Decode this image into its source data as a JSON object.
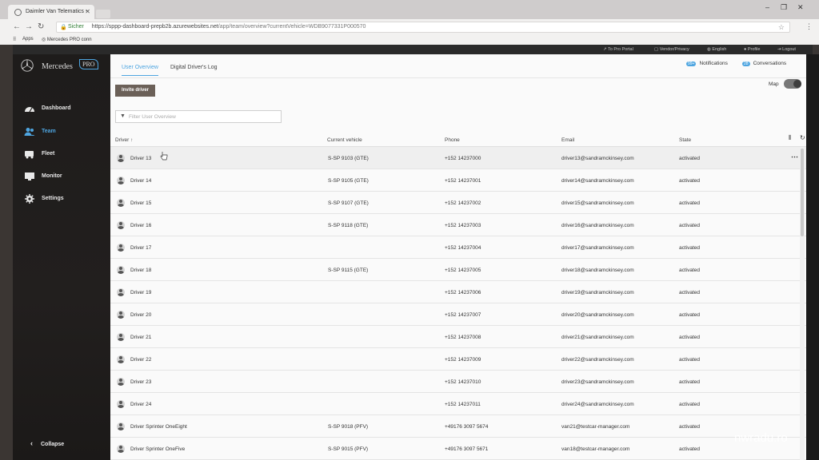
{
  "browser": {
    "tab_title": "Daimler Van Telematics -",
    "url_secure_label": "Sicher",
    "url_host": "https://sppp-dashboard-prepb2b.azurewebsites.net",
    "url_path": "/app/team/overview?currentVehicle=WDB9077331P000570",
    "bookmarks": [
      {
        "label": "Apps"
      },
      {
        "label": "Mercedes PRO conn"
      }
    ]
  },
  "topbar": {
    "items": [
      "To Pro Portal",
      "Vendor/Privacy",
      "English",
      "Profile",
      "Logout"
    ]
  },
  "sidebar": {
    "brand_text": "Mercedes",
    "brand_pro": "PRO",
    "items": [
      {
        "label": "Dashboard",
        "icon": "gauge-icon"
      },
      {
        "label": "Team",
        "icon": "team-icon",
        "active": true
      },
      {
        "label": "Fleet",
        "icon": "van-icon"
      },
      {
        "label": "Monitor",
        "icon": "monitor-icon"
      },
      {
        "label": "Settings",
        "icon": "gear-icon"
      }
    ],
    "collapse_label": "Collapse"
  },
  "main": {
    "tabs": [
      {
        "label": "User Overview",
        "active": true
      },
      {
        "label": "Digital Driver's Log"
      }
    ],
    "notifications": {
      "count": "99+",
      "label": "Notifications"
    },
    "conversations": {
      "count": "28",
      "label": "Conversations"
    },
    "invite_label": "Invite driver",
    "map_label": "Map",
    "filter_placeholder": "Filter User Overview"
  },
  "table": {
    "columns": [
      "Driver ↑",
      "Current vehicle",
      "Phone",
      "Email",
      "State"
    ],
    "rows": [
      {
        "driver": "Driver 13",
        "vehicle": "S-SP 9103 (GTE)",
        "phone": "+152 14237000",
        "email": "driver13@sandramckinsey.com",
        "state": "activated"
      },
      {
        "driver": "Driver 14",
        "vehicle": "S-SP 9105 (GTE)",
        "phone": "+152 14237001",
        "email": "driver14@sandramckinsey.com",
        "state": "activated"
      },
      {
        "driver": "Driver 15",
        "vehicle": "S-SP 9107 (GTE)",
        "phone": "+152 14237002",
        "email": "driver15@sandramckinsey.com",
        "state": "activated"
      },
      {
        "driver": "Driver 16",
        "vehicle": "S-SP 9118 (GTE)",
        "phone": "+152 14237003",
        "email": "driver16@sandramckinsey.com",
        "state": "activated"
      },
      {
        "driver": "Driver 17",
        "vehicle": "",
        "phone": "+152 14237004",
        "email": "driver17@sandramckinsey.com",
        "state": "activated"
      },
      {
        "driver": "Driver 18",
        "vehicle": "S-SP 9115 (GTE)",
        "phone": "+152 14237005",
        "email": "driver18@sandramckinsey.com",
        "state": "activated"
      },
      {
        "driver": "Driver 19",
        "vehicle": "",
        "phone": "+152 14237006",
        "email": "driver19@sandramckinsey.com",
        "state": "activated"
      },
      {
        "driver": "Driver 20",
        "vehicle": "",
        "phone": "+152 14237007",
        "email": "driver20@sandramckinsey.com",
        "state": "activated"
      },
      {
        "driver": "Driver 21",
        "vehicle": "",
        "phone": "+152 14237008",
        "email": "driver21@sandramckinsey.com",
        "state": "activated"
      },
      {
        "driver": "Driver 22",
        "vehicle": "",
        "phone": "+152 14237009",
        "email": "driver22@sandramckinsey.com",
        "state": "activated"
      },
      {
        "driver": "Driver 23",
        "vehicle": "",
        "phone": "+152 14237010",
        "email": "driver23@sandramckinsey.com",
        "state": "activated"
      },
      {
        "driver": "Driver 24",
        "vehicle": "",
        "phone": "+152 14237011",
        "email": "driver24@sandramckinsey.com",
        "state": "activated"
      },
      {
        "driver": "Driver Sprinter OneEight",
        "vehicle": "S-SP 9018 (PFV)",
        "phone": "+49176 3097 5674",
        "email": "van21@testcar-manager.com",
        "state": "activated"
      },
      {
        "driver": "Driver Sprinter OneFive",
        "vehicle": "S-SP 9015 (PFV)",
        "phone": "+49176 3097 5671",
        "email": "van18@testcar-manager.com",
        "state": "activated"
      }
    ]
  },
  "watermark": "nwradu.ro",
  "colors": {
    "accent": "#4ea5e0",
    "invite_button": "#6b6058",
    "sidebar_bg": "#1e1c1b"
  }
}
